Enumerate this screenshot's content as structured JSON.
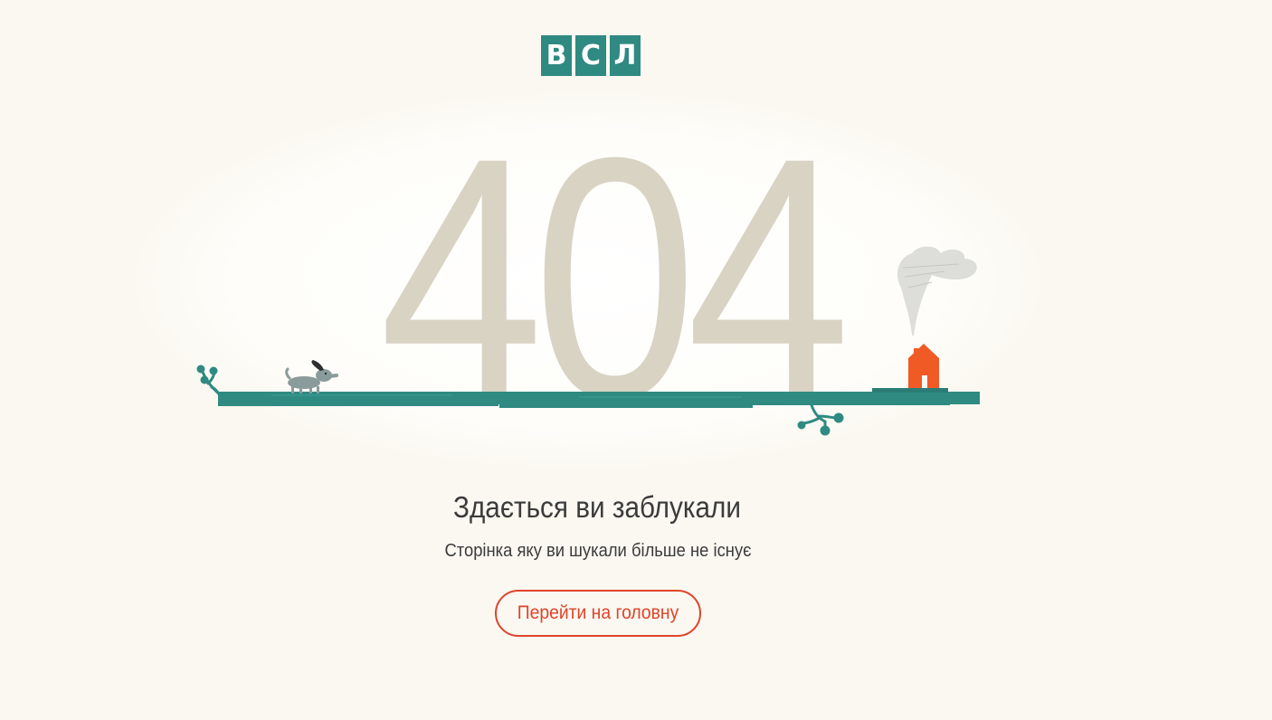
{
  "logo": {
    "letters": [
      "В",
      "С",
      "Л"
    ],
    "color": "#2f8a82"
  },
  "error": {
    "code": "404",
    "heading": "Здається ви заблукали",
    "message": "Сторінка яку ви шукали більше не існує"
  },
  "actions": {
    "home_label": "Перейти на головну"
  },
  "colors": {
    "background": "#faf8f1",
    "ground": "#2f8a82",
    "digits": "#d9d3c4",
    "accent": "#e0442a",
    "house": "#ef5a25"
  },
  "illustration": {
    "icons": [
      "dog-icon",
      "house-icon",
      "smoke-icon",
      "sprout-icon",
      "branch-icon"
    ]
  }
}
